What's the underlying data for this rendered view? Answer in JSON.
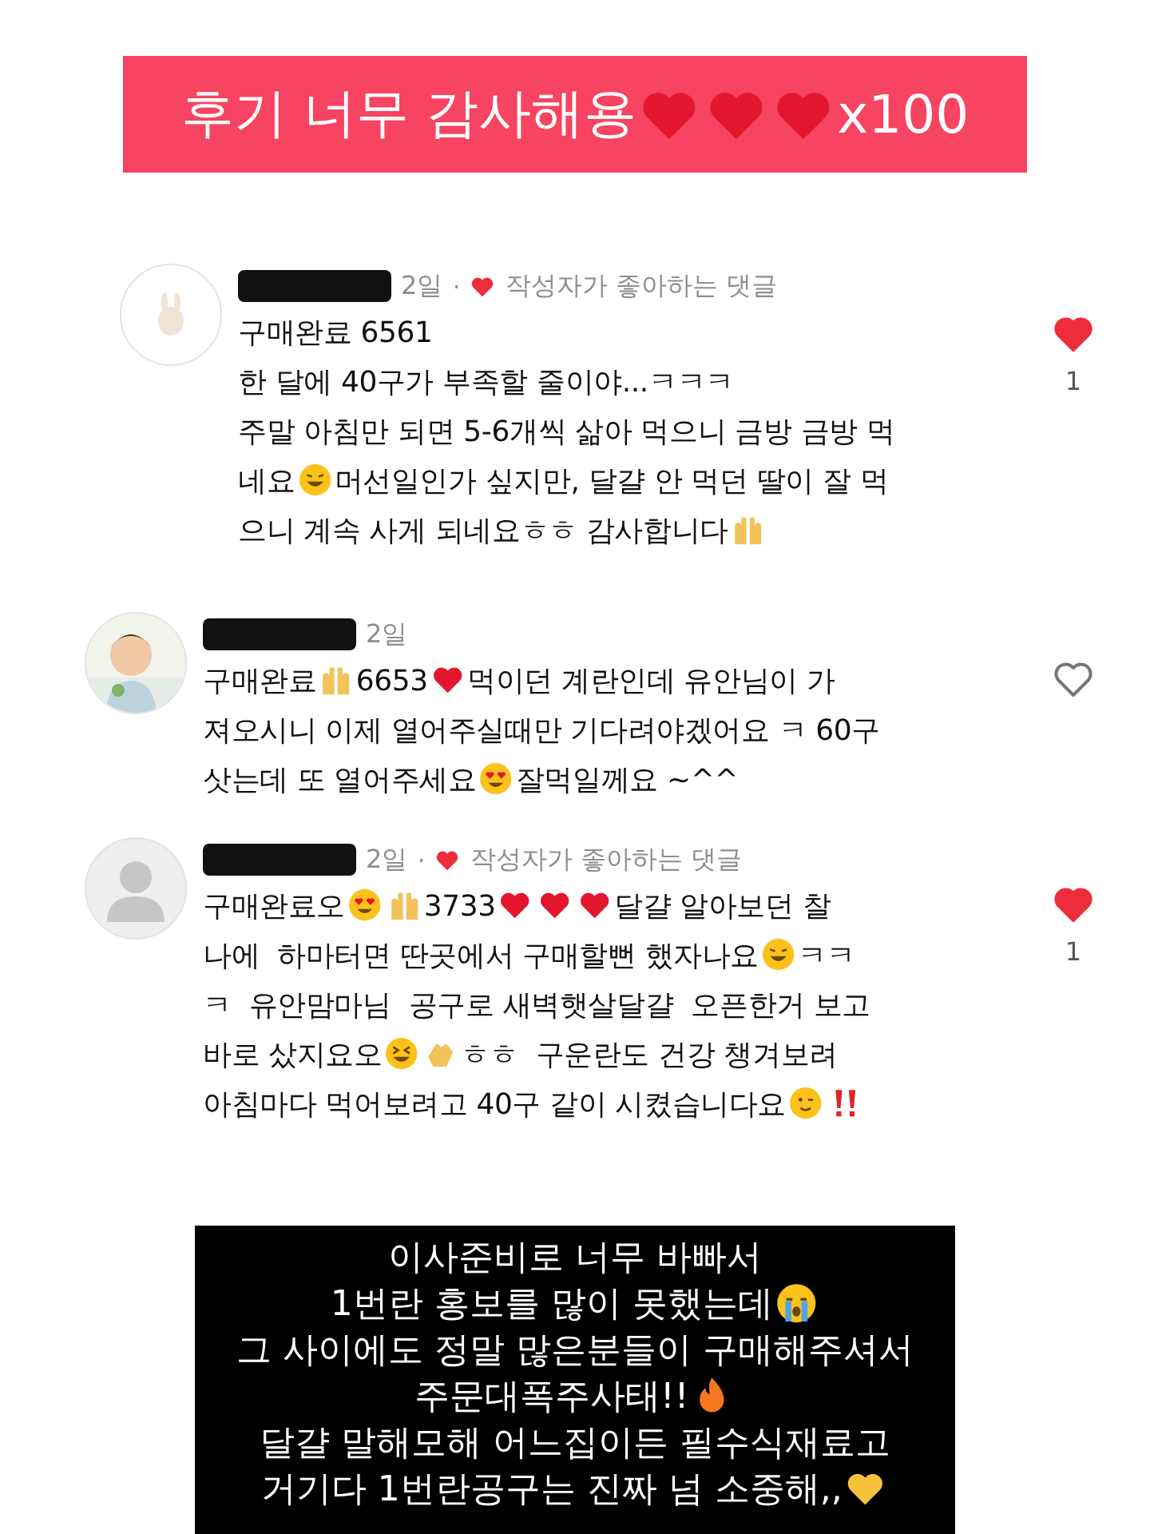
{
  "banner": {
    "runs": [
      {
        "kind": "text",
        "text": "후기 너무 감사해용"
      },
      {
        "kind": "redheart"
      },
      {
        "kind": "redheart"
      },
      {
        "kind": "redheart"
      },
      {
        "kind": "text",
        "text": "x100"
      }
    ]
  },
  "comments": [
    {
      "avatar": {
        "kind": "logo"
      },
      "time": "2일",
      "separator": "·",
      "author_liked": true,
      "author_liked_text": "작성자가 좋아하는 댓글",
      "liked": true,
      "like_count": "1",
      "lines": [
        [
          {
            "kind": "text",
            "text": "구매완료 6561"
          }
        ],
        [
          {
            "kind": "text",
            "text": "한 달에 40구가 부족할 줄이야...ㅋㅋㅋ"
          }
        ],
        [
          {
            "kind": "text",
            "text": "주말 아침만 되면 5-6개씩 삶아 먹으니 금방 금방 먹"
          }
        ],
        [
          {
            "kind": "text",
            "text": "네요"
          },
          {
            "kind": "rofl"
          },
          {
            "kind": "text",
            "text": "머선일인가 싶지만, 달걀 안 먹던 딸이 잘 먹"
          }
        ],
        [
          {
            "kind": "text",
            "text": "으니 계속 사게 되네요ㅎㅎ 감사합니다"
          },
          {
            "kind": "raisedhands"
          }
        ]
      ]
    },
    {
      "avatar": {
        "kind": "picture"
      },
      "time": "2일",
      "author_liked": false,
      "liked": false,
      "lines": [
        [
          {
            "kind": "text",
            "text": "구매완료"
          },
          {
            "kind": "raisedhands"
          },
          {
            "kind": "text",
            "text": "6653"
          },
          {
            "kind": "redheart"
          },
          {
            "kind": "text",
            "text": "먹이던 계란인데 유안님이 가"
          }
        ],
        [
          {
            "kind": "text",
            "text": "져오시니 이제 열어주실때만 기다려야겠어요 ㅋ 60구"
          }
        ],
        [
          {
            "kind": "text",
            "text": "삿는데 또 열어주세요"
          },
          {
            "kind": "hearteyes"
          },
          {
            "kind": "text",
            "text": "잘먹일께요 ~^^"
          }
        ]
      ]
    },
    {
      "avatar": {
        "kind": "default"
      },
      "time": "2일",
      "separator": "·",
      "author_liked": true,
      "author_liked_text": "작성자가 좋아하는 댓글",
      "liked": true,
      "like_count": "1",
      "lines": [
        [
          {
            "kind": "text",
            "text": "구매완료오"
          },
          {
            "kind": "hearteyes"
          },
          {
            "kind": "raisedhands"
          },
          {
            "kind": "text",
            "text": "3733"
          },
          {
            "kind": "redheart"
          },
          {
            "kind": "redheart"
          },
          {
            "kind": "redheart"
          },
          {
            "kind": "text",
            "text": "달걀 알아보던 찰"
          }
        ],
        [
          {
            "kind": "text",
            "text": "나에  하마터면 딴곳에서 구매할뻔 했자나요"
          },
          {
            "kind": "rofl"
          },
          {
            "kind": "text",
            "text": "ㅋㅋ"
          }
        ],
        [
          {
            "kind": "text",
            "text": "ㅋ  유안맘마님  공구로 새벽햇살달걀  오픈한거 보고"
          }
        ],
        [
          {
            "kind": "text",
            "text": "바로 샀지요오"
          },
          {
            "kind": "grinsquint"
          },
          {
            "kind": "clap"
          },
          {
            "kind": "text",
            "text": "ㅎㅎ  구운란도 건강 챙겨보려"
          }
        ],
        [
          {
            "kind": "text",
            "text": "아침마다 먹어보려고 40구 같이 시켰습니다요"
          },
          {
            "kind": "wink"
          },
          {
            "kind": "bangbang"
          }
        ]
      ]
    }
  ],
  "notice": {
    "lines": [
      [
        {
          "kind": "text",
          "text": "이사준비로 너무 바빠서"
        }
      ],
      [
        {
          "kind": "text",
          "text": "1번란 홍보를 많이 못했는데"
        },
        {
          "kind": "sob"
        }
      ],
      [
        {
          "kind": "text",
          "text": "그 사이에도 정말 많은분들이 구매해주셔서"
        }
      ],
      [
        {
          "kind": "text",
          "text": "주문대폭주사태!!"
        },
        {
          "kind": "fire"
        }
      ],
      [
        {
          "kind": "text",
          "text": "달걀 말해모해 어느집이든 필수식재료고"
        }
      ],
      [
        {
          "kind": "text",
          "text": "거기다 1번란공구는 진짜 넘 소중해,,"
        },
        {
          "kind": "yellowheart"
        }
      ]
    ]
  }
}
